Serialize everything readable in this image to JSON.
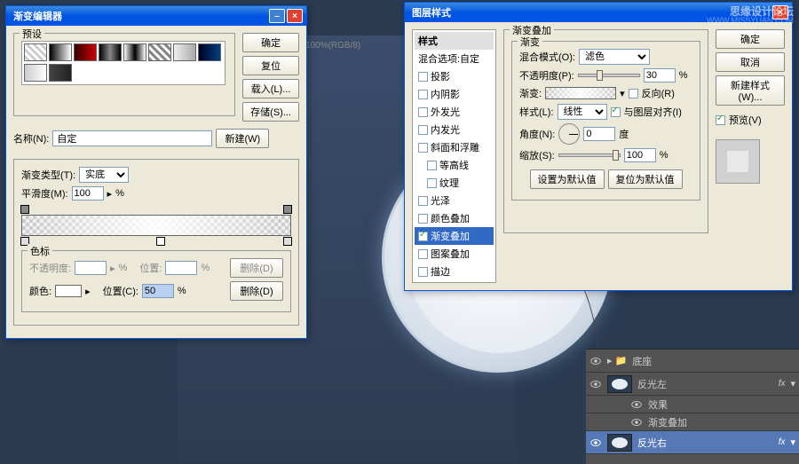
{
  "watermark": {
    "text": "思缘设计论坛",
    "url": "WWW.MISSYUAN.COM"
  },
  "doc_title": "100%(RGB/8)",
  "gradient_editor": {
    "title": "渐变编辑器",
    "presets_label": "预设",
    "ok": "确定",
    "reset": "复位",
    "load": "载入(L)...",
    "save": "存储(S)...",
    "name_label": "名称(N):",
    "name_value": "自定",
    "new_btn": "新建(W)",
    "type_label": "渐变类型(T):",
    "type_value": "实底",
    "smooth_label": "平滑度(M):",
    "smooth_value": "100",
    "percent": "%",
    "stops_label": "色标",
    "opacity_label": "不透明度:",
    "pos_label": "位置:",
    "pos2_label": "位置(C):",
    "pos2_value": "50",
    "color_label": "颜色:",
    "delete": "删除(D)"
  },
  "layer_style": {
    "title": "图层样式",
    "styles_header": "样式",
    "blend_options": "混合选项:自定",
    "items": [
      {
        "label": "投影",
        "checked": false
      },
      {
        "label": "内阴影",
        "checked": false
      },
      {
        "label": "外发光",
        "checked": false
      },
      {
        "label": "内发光",
        "checked": false
      },
      {
        "label": "斜面和浮雕",
        "checked": false
      },
      {
        "label": "等高线",
        "checked": false,
        "indent": true
      },
      {
        "label": "纹理",
        "checked": false,
        "indent": true
      },
      {
        "label": "光泽",
        "checked": false
      },
      {
        "label": "颜色叠加",
        "checked": false
      },
      {
        "label": "渐变叠加",
        "checked": true,
        "selected": true
      },
      {
        "label": "图案叠加",
        "checked": false
      },
      {
        "label": "描边",
        "checked": false
      }
    ],
    "panel_title": "渐变叠加",
    "grad_label": "渐变",
    "blend_mode_label": "混合模式(O):",
    "blend_mode_value": "滤色",
    "opacity_label": "不透明度(P):",
    "opacity_value": "30",
    "percent": "%",
    "gradient_label": "渐变:",
    "reverse_label": "反向(R)",
    "style_label": "样式(L):",
    "style_value": "线性",
    "align_label": "与图层对齐(I)",
    "angle_label": "角度(N):",
    "angle_value": "0",
    "degree": "度",
    "scale_label": "缩放(S):",
    "scale_value": "100",
    "set_default": "设置为默认值",
    "reset_default": "复位为默认值",
    "ok": "确定",
    "cancel": "取消",
    "new_style": "新建样式(W)...",
    "preview_label": "预览(V)"
  },
  "layers": {
    "group": "底座",
    "item1": "反光左",
    "fx": "fx",
    "effects": "效果",
    "grad_overlay": "渐变叠加",
    "item2": "反光右"
  }
}
